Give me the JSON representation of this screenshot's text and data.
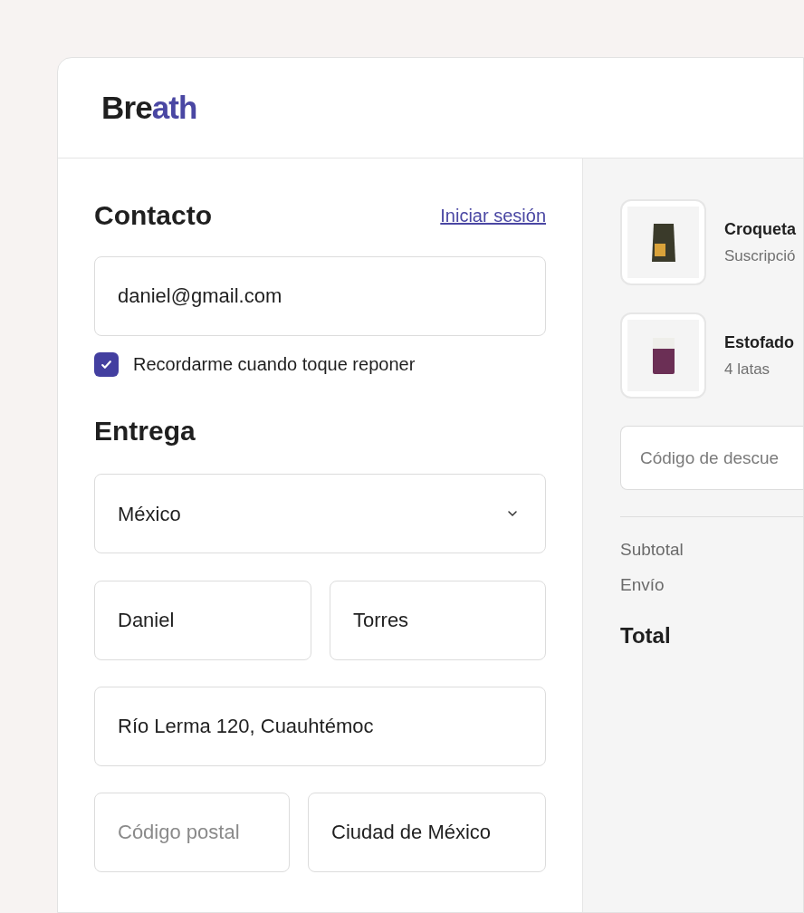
{
  "logo": {
    "dark": "Bre",
    "accent": "ath"
  },
  "contact": {
    "title": "Contacto",
    "login_link": "Iniciar sesión",
    "email": "daniel@gmail.com",
    "remember": {
      "label": "Recordarme cuando toque reponer",
      "checked": true
    }
  },
  "delivery": {
    "title": "Entrega",
    "country": "México",
    "first_name": "Daniel",
    "last_name": "Torres",
    "address": "Río Lerma 120, Cuauhtémoc",
    "postal_code": {
      "placeholder": "Código postal"
    },
    "city": "Ciudad de México"
  },
  "summary": {
    "items": [
      {
        "name": "Croqueta",
        "detail": "Suscripció",
        "kind": "bag"
      },
      {
        "name": "Estofado",
        "detail": "4 latas",
        "kind": "can"
      }
    ],
    "discount": {
      "placeholder": "Código de descue"
    },
    "lines": [
      {
        "label": "Subtotal",
        "kind": "line"
      },
      {
        "label": "Envío",
        "kind": "line"
      },
      {
        "label": "Total",
        "kind": "total"
      }
    ]
  }
}
